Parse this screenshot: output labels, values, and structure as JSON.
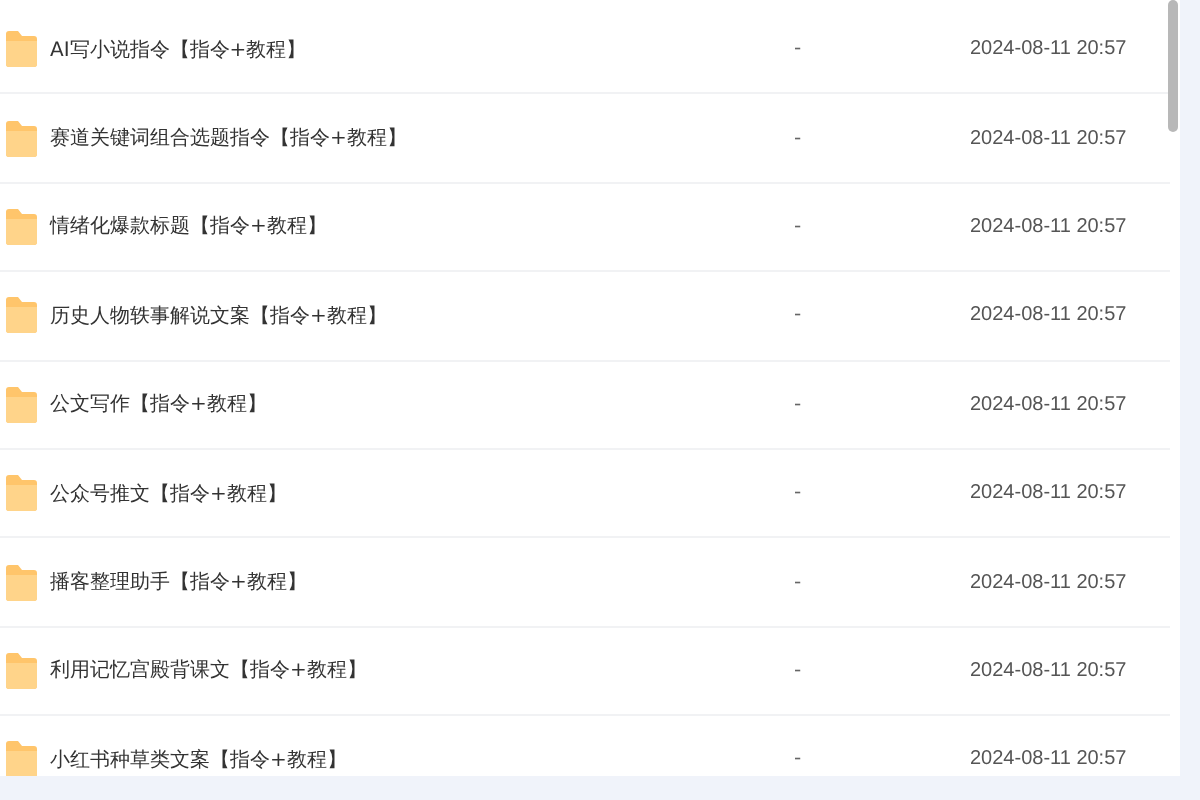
{
  "files": [
    {
      "name": "AI写小说指令【指令+教程】",
      "size": "-",
      "modified": "2024-08-11 20:57"
    },
    {
      "name": "赛道关键词组合选题指令【指令+教程】",
      "size": "-",
      "modified": "2024-08-11 20:57"
    },
    {
      "name": "情绪化爆款标题【指令+教程】",
      "size": "-",
      "modified": "2024-08-11 20:57"
    },
    {
      "name": "历史人物轶事解说文案【指令+教程】",
      "size": "-",
      "modified": "2024-08-11 20:57"
    },
    {
      "name": "公文写作【指令+教程】",
      "size": "-",
      "modified": "2024-08-11 20:57"
    },
    {
      "name": "公众号推文【指令+教程】",
      "size": "-",
      "modified": "2024-08-11 20:57"
    },
    {
      "name": "播客整理助手【指令+教程】",
      "size": "-",
      "modified": "2024-08-11 20:57"
    },
    {
      "name": "利用记忆宫殿背课文【指令+教程】",
      "size": "-",
      "modified": "2024-08-11 20:57"
    },
    {
      "name": "小红书种草类文案【指令+教程】",
      "size": "-",
      "modified": "2024-08-11 20:57"
    }
  ]
}
